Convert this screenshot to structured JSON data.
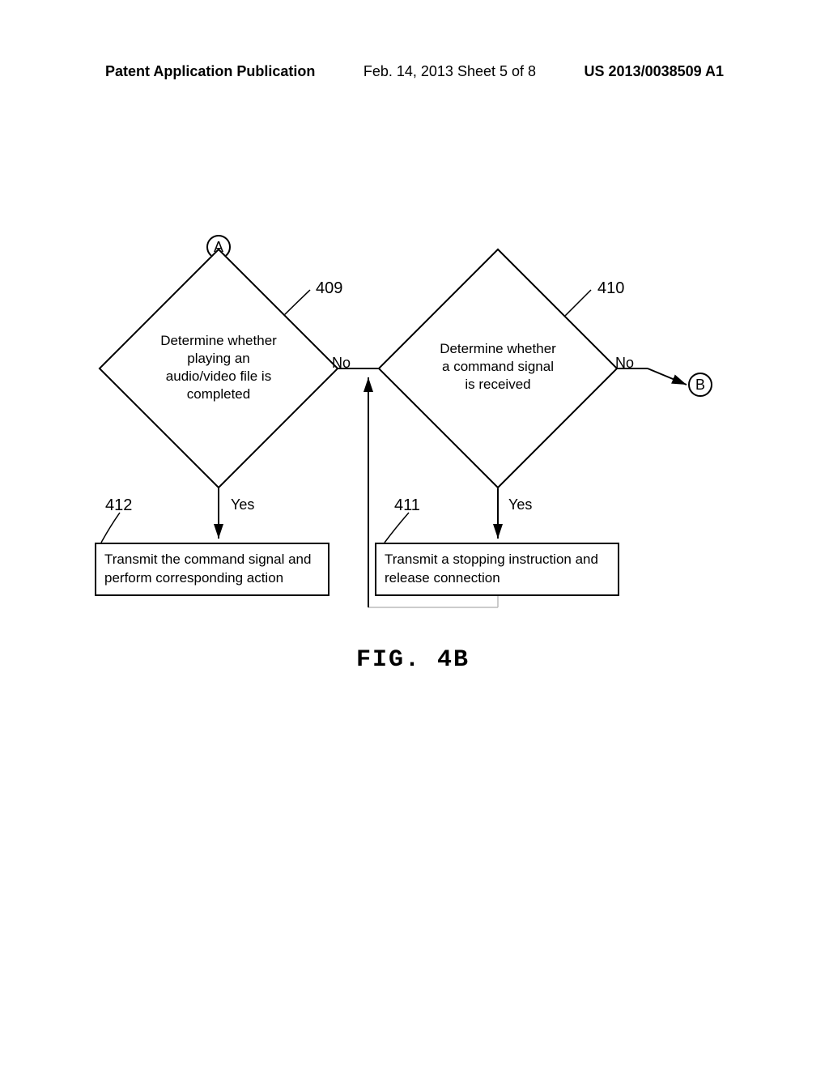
{
  "header": {
    "pub_type": "Patent Application Publication",
    "date_sheet": "Feb. 14, 2013  Sheet 5 of 8",
    "pub_number": "US 2013/0038509 A1"
  },
  "connectors": {
    "A": "A",
    "B": "B"
  },
  "diamonds": {
    "d409": {
      "ref": "409",
      "text": "Determine whether playing an audio/video file is completed"
    },
    "d410": {
      "ref": "410",
      "text": "Determine whether a command signal is received"
    }
  },
  "rects": {
    "r412": {
      "ref": "412",
      "text": "Transmit the command signal and perform corresponding action"
    },
    "r411": {
      "ref": "411",
      "text": "Transmit a stopping instruction and release connection"
    }
  },
  "edges": {
    "no": "No",
    "yes": "Yes"
  },
  "figure": "FIG. 4B"
}
